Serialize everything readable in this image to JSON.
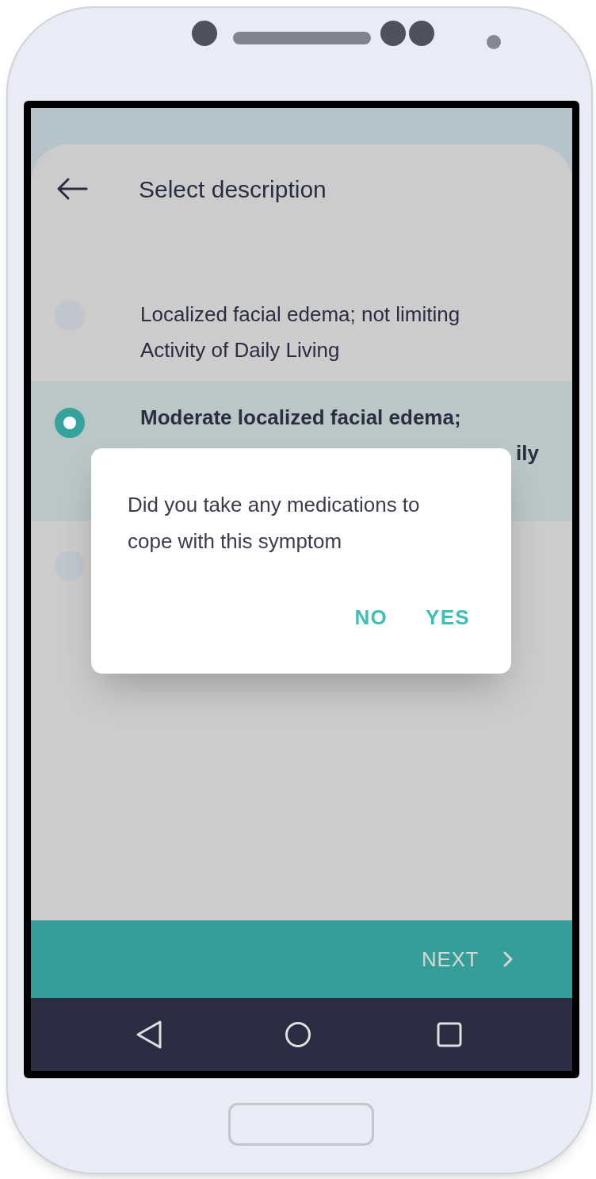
{
  "screen": {
    "title": "Select description",
    "options": [
      {
        "lines": [
          "Localized facial edema; not limiting",
          "Activity of Daily Living"
        ],
        "selected": false
      },
      {
        "lines": [
          "Moderate localized facial edema;"
        ],
        "peek": "ily",
        "selected": true
      },
      {
        "selected": false
      }
    ]
  },
  "dialog": {
    "message": "Did you take any medications to cope with this symptom",
    "buttons": [
      "NO",
      "YES"
    ]
  },
  "next_button": "NEXT"
}
